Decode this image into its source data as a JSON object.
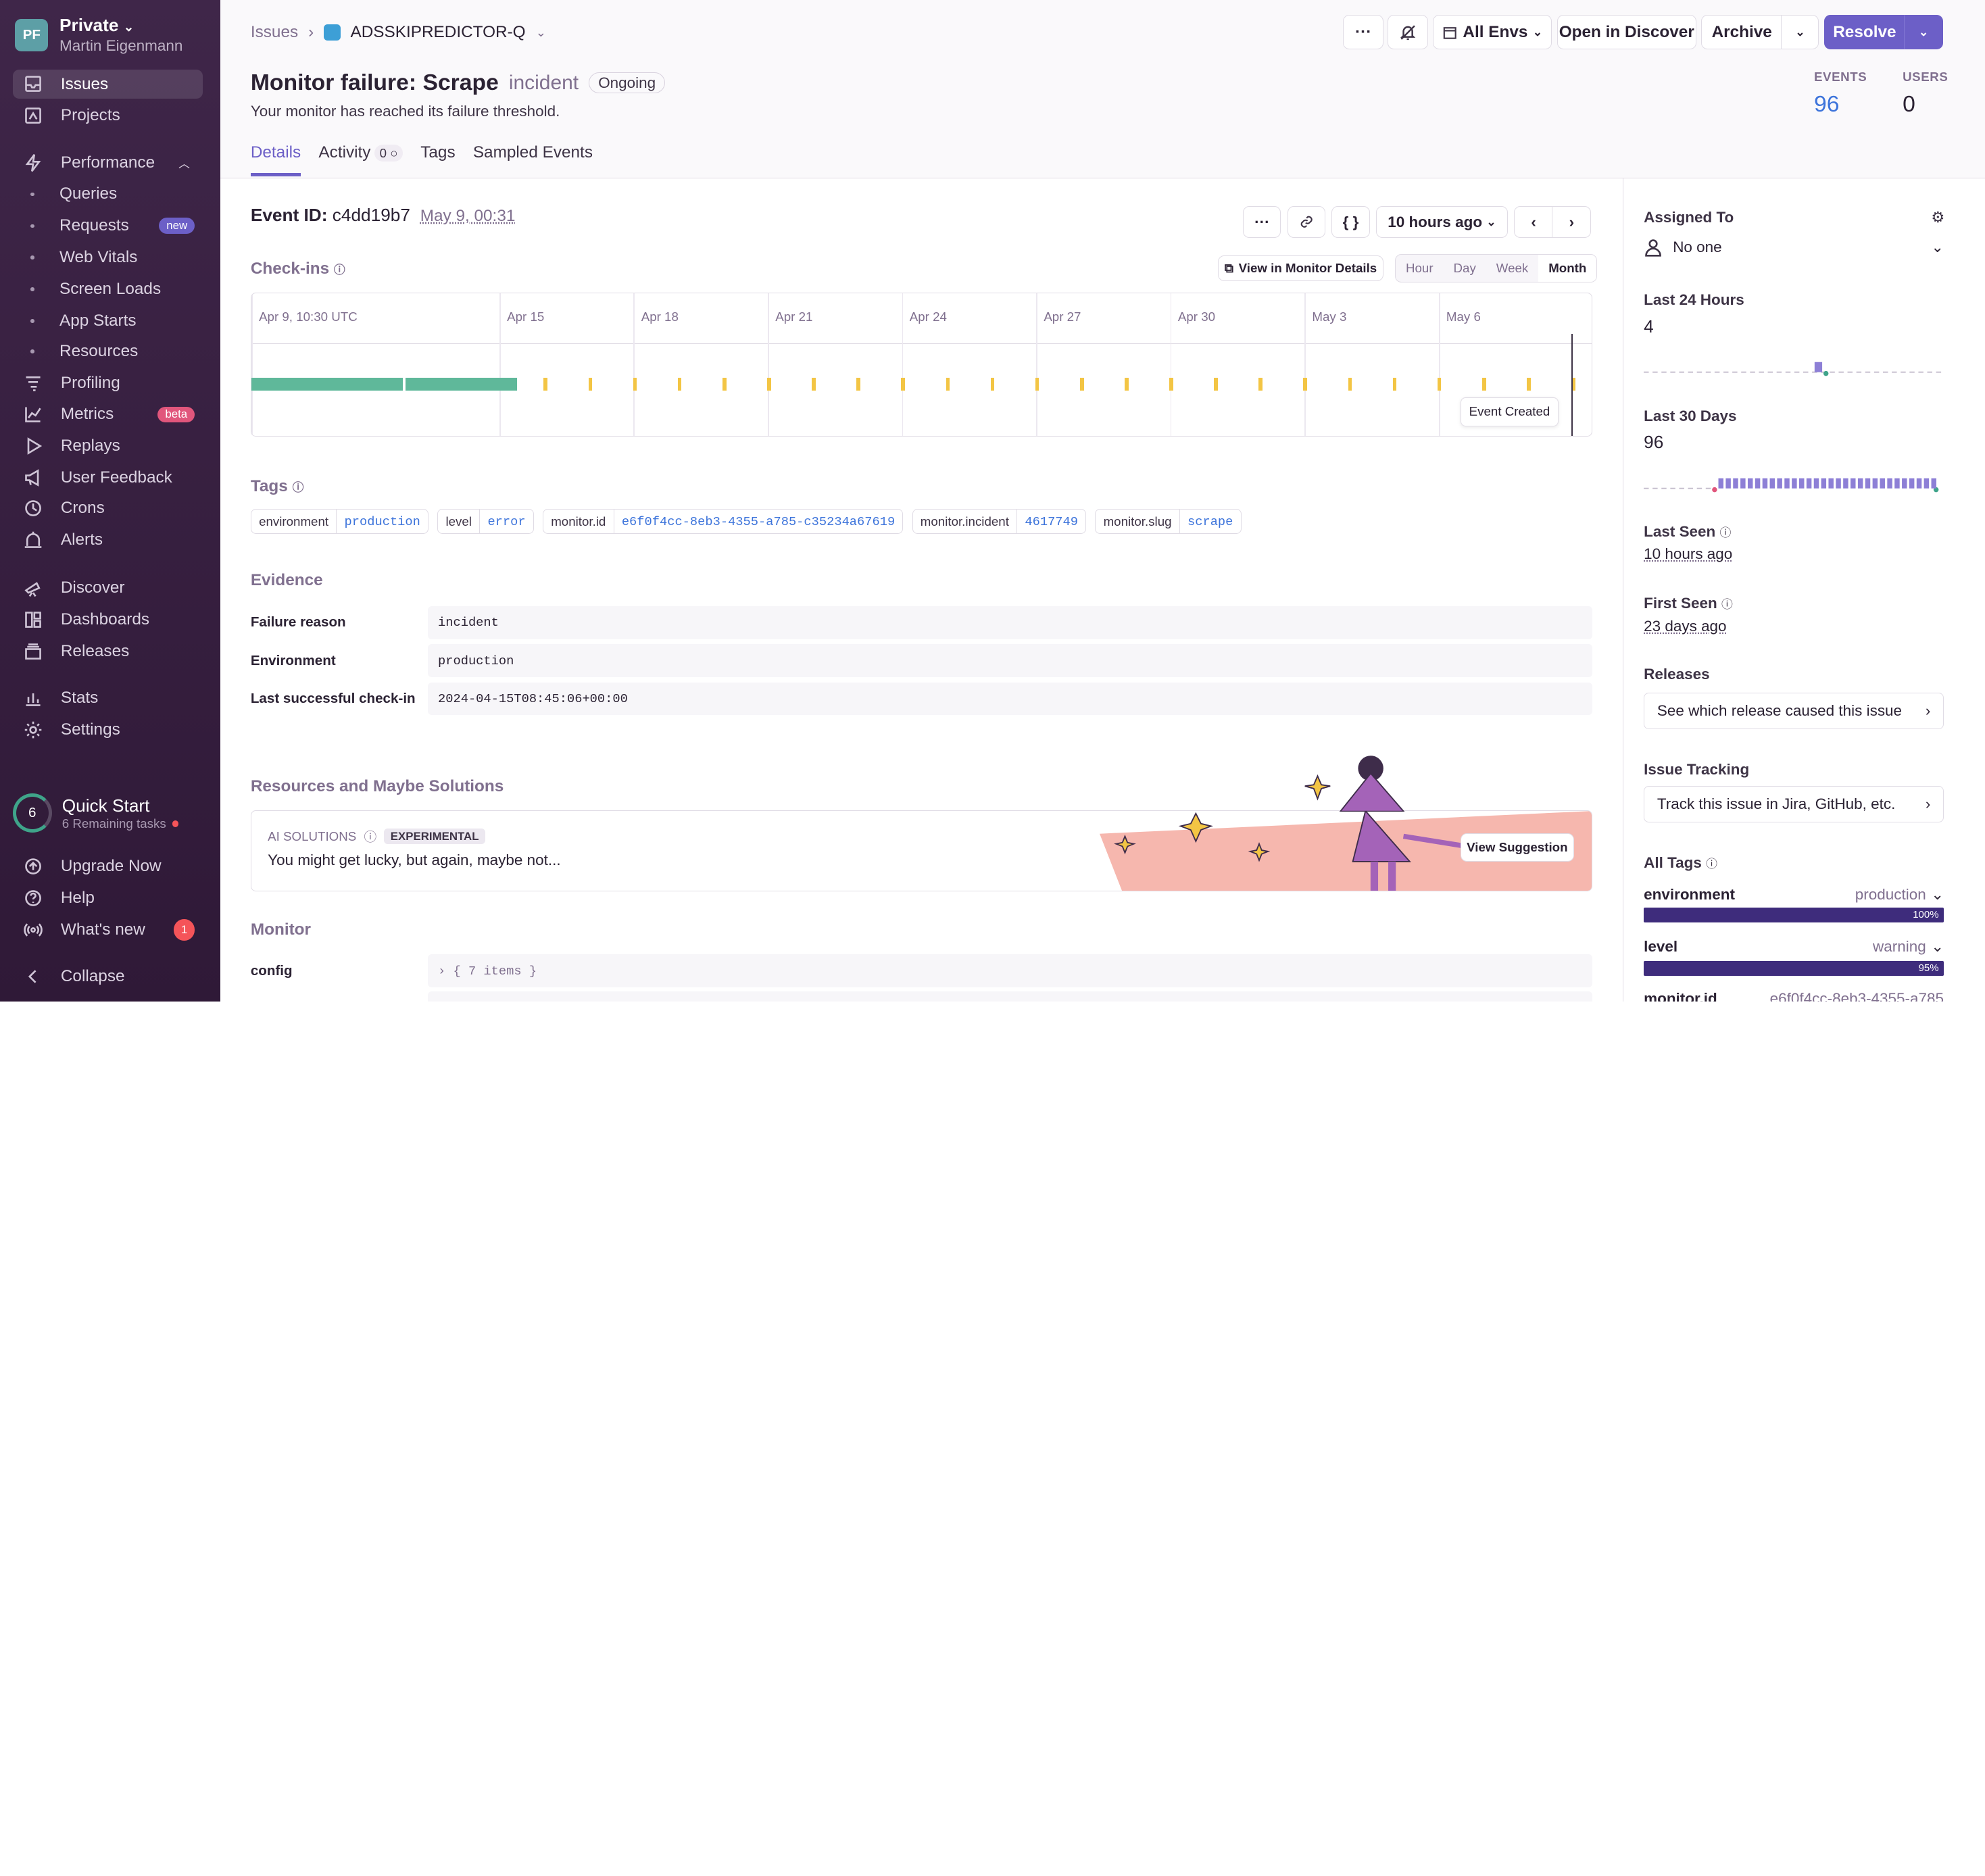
{
  "sidebar": {
    "org_initials": "PF",
    "org_name": "Private",
    "user": "Martin Eigenmann",
    "items": [
      {
        "label": "Issues",
        "icon": "inbox-icon"
      },
      {
        "label": "Projects",
        "icon": "projects-icon"
      },
      {
        "label": "Performance",
        "icon": "lightning-icon"
      },
      {
        "label": "Queries"
      },
      {
        "label": "Requests",
        "badge": "new"
      },
      {
        "label": "Web Vitals"
      },
      {
        "label": "Screen Loads"
      },
      {
        "label": "App Starts"
      },
      {
        "label": "Resources"
      },
      {
        "label": "Profiling",
        "icon": "profiling-icon"
      },
      {
        "label": "Metrics",
        "icon": "metrics-icon",
        "badge": "beta"
      },
      {
        "label": "Replays",
        "icon": "play-icon"
      },
      {
        "label": "User Feedback",
        "icon": "megaphone-icon"
      },
      {
        "label": "Crons",
        "icon": "clock-icon"
      },
      {
        "label": "Alerts",
        "icon": "siren-icon"
      },
      {
        "label": "Discover",
        "icon": "telescope-icon"
      },
      {
        "label": "Dashboards",
        "icon": "dashboard-icon"
      },
      {
        "label": "Releases",
        "icon": "releases-icon"
      },
      {
        "label": "Stats",
        "icon": "stats-icon"
      },
      {
        "label": "Settings",
        "icon": "gear-icon"
      }
    ],
    "quickstart": {
      "count": "6",
      "title": "Quick Start",
      "sub": "6 Remaining tasks"
    },
    "bottom": [
      {
        "label": "Upgrade Now"
      },
      {
        "label": "Help"
      },
      {
        "label": "What's new",
        "badge": "1"
      },
      {
        "label": "Collapse"
      }
    ]
  },
  "header": {
    "crumb_issues": "Issues",
    "project": "ADSSKIPREDICTOR-Q",
    "more": "···",
    "envs": "All Envs",
    "open_discover": "Open in Discover",
    "archive": "Archive",
    "resolve": "Resolve",
    "title": "Monitor failure: Scrape",
    "subtitle": "incident",
    "status": "Ongoing",
    "message": "Your monitor has reached its failure threshold.",
    "events_label": "EVENTS",
    "events": "96",
    "users_label": "USERS",
    "users": "0",
    "tabs": [
      {
        "label": "Details"
      },
      {
        "label": "Activity",
        "count": "0"
      },
      {
        "label": "Tags"
      },
      {
        "label": "Sampled Events"
      }
    ]
  },
  "event": {
    "id_label": "Event ID:",
    "id": "c4dd19b7",
    "date": "May 9, 00:31",
    "ago": "10 hours ago",
    "checkins_label": "Check-ins",
    "view_monitor": "View in Monitor Details",
    "periods": [
      "Hour",
      "Day",
      "Week",
      "Month"
    ],
    "period_selected": "Month",
    "timeline_labels": [
      "Apr 9, 10:30 UTC",
      "Apr 15",
      "Apr 18",
      "Apr 21",
      "Apr 24",
      "Apr 27",
      "Apr 30",
      "May 3",
      "May 6"
    ],
    "tooltip": "Event Created",
    "checkins": {
      "ok_until_fraction": 0.198,
      "error_count": 24,
      "colors": {
        "ok": "#5fb89a",
        "error": "#f3c544"
      }
    }
  },
  "tags_label": "Tags",
  "tags": [
    {
      "k": "environment",
      "v": "production"
    },
    {
      "k": "level",
      "v": "error"
    },
    {
      "k": "monitor.id",
      "v": "e6f0f4cc-8eb3-4355-a785-c35234a67619"
    },
    {
      "k": "monitor.incident",
      "v": "4617749"
    },
    {
      "k": "monitor.slug",
      "v": "scrape"
    }
  ],
  "evidence": {
    "label": "Evidence",
    "rows": [
      {
        "k": "Failure reason",
        "v": "incident"
      },
      {
        "k": "Environment",
        "v": "production"
      },
      {
        "k": "Last successful check-in",
        "v": "2024-04-15T08:45:06+00:00"
      }
    ]
  },
  "resources": {
    "label": "Resources and Maybe Solutions",
    "ai": "AI SOLUTIONS",
    "exp": "EXPERIMENTAL",
    "text": "You might get lucky, but again, maybe not...",
    "button": "View Suggestion"
  },
  "monitor": {
    "label": "Monitor",
    "config_k": "config",
    "config_v": "{ 7 items }"
  },
  "aside": {
    "assigned": "Assigned To",
    "no_one": "No one",
    "last24": "Last 24 Hours",
    "last24_v": "4",
    "last30": "Last 30 Days",
    "last30_v": "96",
    "last_seen": "Last Seen",
    "last_seen_v": "10 hours ago",
    "first_seen": "First Seen",
    "first_seen_v": "23 days ago",
    "releases": "Releases",
    "releases_btn": "See which release caused this issue",
    "tracking": "Issue Tracking",
    "tracking_btn": "Track this issue in Jira, GitHub, etc.",
    "all_tags": "All Tags",
    "tag_rows": [
      {
        "k": "environment",
        "v": "production",
        "pct": "100%",
        "frac": 1.0
      },
      {
        "k": "level",
        "v": "warning",
        "pct": "95%",
        "frac": 0.95
      },
      {
        "k": "monitor.id",
        "v": "e6f0f4cc-8eb3-4355-a785"
      }
    ]
  }
}
